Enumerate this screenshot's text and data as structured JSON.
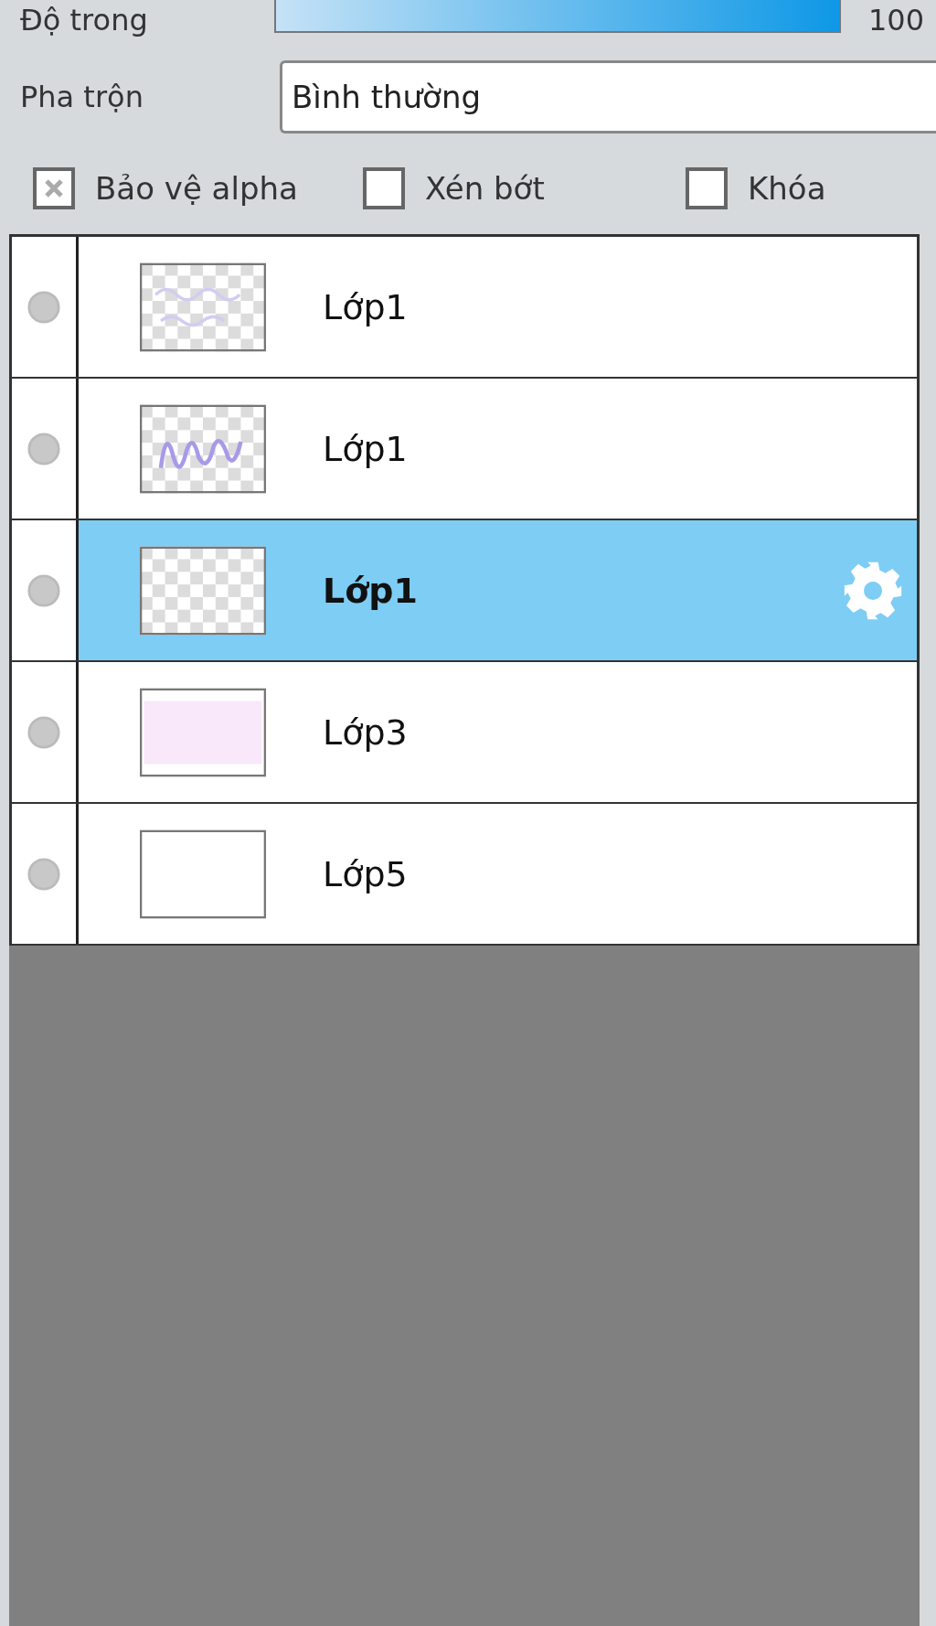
{
  "opacity": {
    "label": "Độ trong",
    "level": 1,
    "value": "100"
  },
  "blend": {
    "label": "Pha trộn",
    "value": "Bình thường"
  },
  "options": [
    {
      "label": "Bảo vệ alpha",
      "checked": true
    },
    {
      "label": "Xén bớt",
      "checked": false
    },
    {
      "label": "Khóa",
      "checked": false
    }
  ],
  "layers": [
    {
      "name": "Lớp1",
      "selected": false,
      "kind": "faint"
    },
    {
      "name": "Lớp1",
      "selected": false,
      "kind": "scribble"
    },
    {
      "name": "Lớp1",
      "selected": true,
      "kind": "empty"
    },
    {
      "name": "Lớp3",
      "selected": false,
      "kind": "pink"
    },
    {
      "name": "Lớp5",
      "selected": false,
      "kind": "blank"
    }
  ]
}
